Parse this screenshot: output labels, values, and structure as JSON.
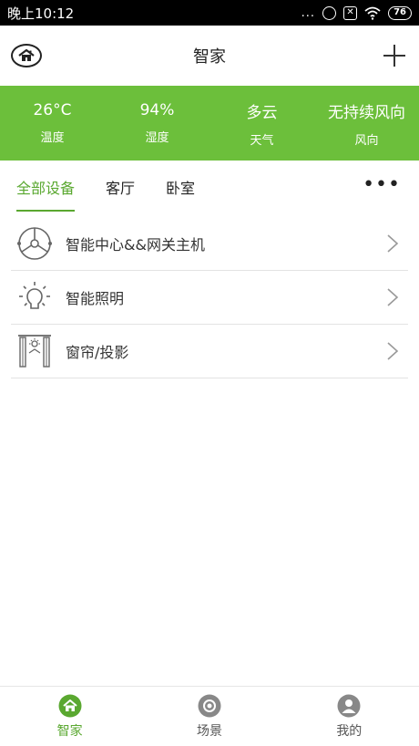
{
  "status_bar": {
    "time": "晚上10:12",
    "dots": "...",
    "battery": "76"
  },
  "header": {
    "title": "智家"
  },
  "weather": [
    {
      "value": "26°C",
      "label": "温度"
    },
    {
      "value": "94%",
      "label": "湿度"
    },
    {
      "value": "多云",
      "label": "天气"
    },
    {
      "value": "无持续风向",
      "label": "风向"
    }
  ],
  "tabs": {
    "items": [
      "全部设备",
      "客厅",
      "卧室"
    ],
    "active_index": 0,
    "more": "•••"
  },
  "devices": [
    {
      "name": "智能中心&&网关主机",
      "icon": "gateway-icon"
    },
    {
      "name": "智能照明",
      "icon": "lightbulb-icon"
    },
    {
      "name": "窗帘/投影",
      "icon": "curtain-icon"
    }
  ],
  "bottom_nav": [
    {
      "label": "智家",
      "icon": "home-icon",
      "active": true
    },
    {
      "label": "场景",
      "icon": "scene-icon",
      "active": false
    },
    {
      "label": "我的",
      "icon": "profile-icon",
      "active": false
    }
  ],
  "colors": {
    "accent": "#5aa830",
    "banner": "#6cbf3b",
    "status_bar": "#000000"
  }
}
